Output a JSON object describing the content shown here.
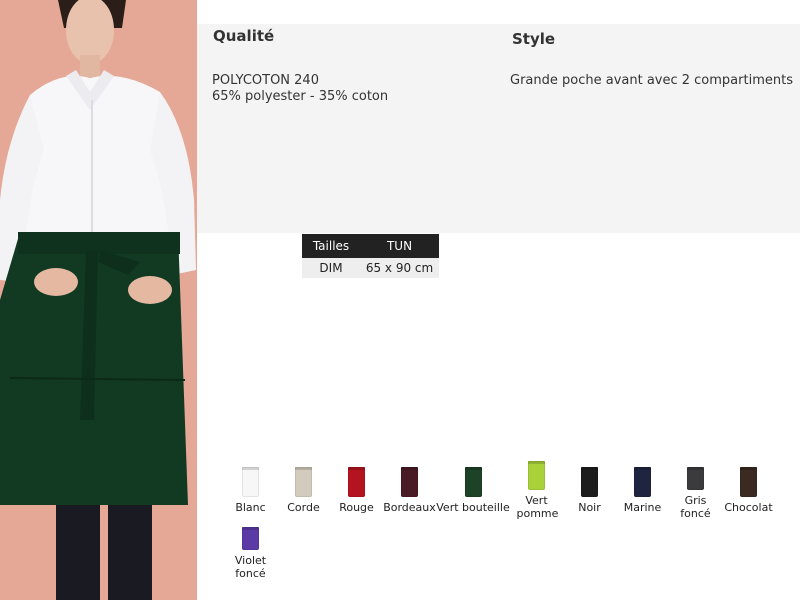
{
  "info": {
    "quality_heading": "Qualité",
    "style_heading": "Style",
    "quality_lines": [
      "POLYCOTON 240",
      "65% polyester - 35% coton"
    ],
    "style_text": "Grande poche avant avec 2 compartiments"
  },
  "size_table": {
    "header": [
      "Tailles",
      "TUN"
    ],
    "row": [
      "DIM",
      "65 x 90 cm"
    ]
  },
  "colors": [
    {
      "name": "Blanc",
      "hex": "#f7f7f7"
    },
    {
      "name": "Corde",
      "hex": "#d3cbbd"
    },
    {
      "name": "Rouge",
      "hex": "#b3141f"
    },
    {
      "name": "Bordeaux",
      "hex": "#4a1a25"
    },
    {
      "name": "Vert bouteille",
      "hex": "#1c4227"
    },
    {
      "name": "Vert pomme",
      "hex": "#a8d13a"
    },
    {
      "name": "Noir",
      "hex": "#1d1d1d"
    },
    {
      "name": "Marine",
      "hex": "#1f2440"
    },
    {
      "name": "Gris foncé",
      "hex": "#3b3b3d"
    },
    {
      "name": "Chocolat",
      "hex": "#3a2a22"
    },
    {
      "name": "Violet foncé",
      "hex": "#5b3aa6"
    }
  ]
}
